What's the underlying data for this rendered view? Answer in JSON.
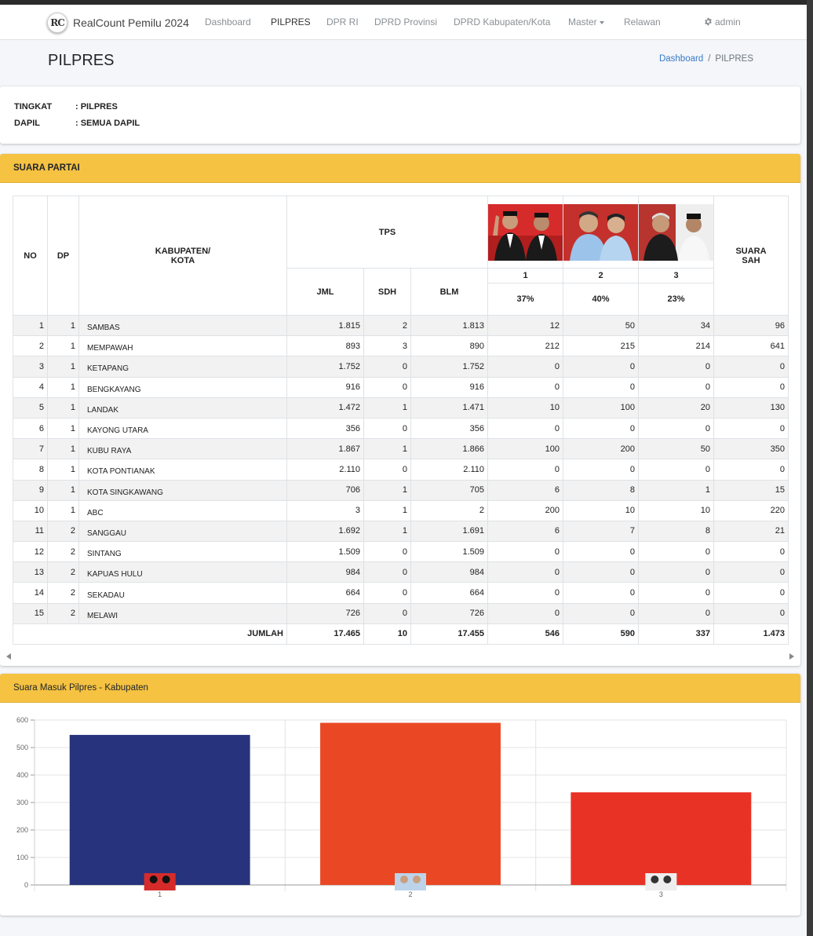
{
  "brand": {
    "logo_text": "RC",
    "name": "RealCount Pemilu 2024"
  },
  "nav": {
    "items": [
      {
        "label": "Dashboard"
      },
      {
        "label": "PILPRES"
      },
      {
        "label": "DPR RI"
      },
      {
        "label": "DPRD Provinsi"
      },
      {
        "label": "DPRD Kabupaten/Kota"
      },
      {
        "label": "Master"
      },
      {
        "label": "Relawan"
      }
    ],
    "user": "admin"
  },
  "page": {
    "title": "PILPRES"
  },
  "breadcrumb": {
    "home": "Dashboard",
    "current": "PILPRES"
  },
  "info": {
    "tingkat_label": "TINGKAT",
    "tingkat_value": ": PILPRES",
    "dapil_label": "DAPIL",
    "dapil_value": ": SEMUA DAPIL"
  },
  "table_card": {
    "title": "SUARA PARTAI"
  },
  "table": {
    "headers": {
      "no": "NO",
      "dp": "DP",
      "kab_line1": "KABUPATEN/",
      "kab_line2": "KOTA",
      "tps": "TPS",
      "jml": "JML",
      "sdh": "SDH",
      "blm": "BLM",
      "suara_line1": "SUARA",
      "suara_line2": "SAH"
    },
    "candidates": [
      {
        "no": "1",
        "pct": "37%",
        "bg": "#d62b2b"
      },
      {
        "no": "2",
        "pct": "40%",
        "bg": "#bcd3ea"
      },
      {
        "no": "3",
        "pct": "23%",
        "bg": "#b8342f"
      }
    ],
    "rows": [
      {
        "no": "1",
        "dp": "1",
        "name": "SAMBAS",
        "jml": "1.815",
        "sdh": "2",
        "blm": "1.813",
        "c1": "12",
        "c2": "50",
        "c3": "34",
        "sah": "96"
      },
      {
        "no": "2",
        "dp": "1",
        "name": "MEMPAWAH",
        "jml": "893",
        "sdh": "3",
        "blm": "890",
        "c1": "212",
        "c2": "215",
        "c3": "214",
        "sah": "641"
      },
      {
        "no": "3",
        "dp": "1",
        "name": "KETAPANG",
        "jml": "1.752",
        "sdh": "0",
        "blm": "1.752",
        "c1": "0",
        "c2": "0",
        "c3": "0",
        "sah": "0"
      },
      {
        "no": "4",
        "dp": "1",
        "name": "BENGKAYANG",
        "jml": "916",
        "sdh": "0",
        "blm": "916",
        "c1": "0",
        "c2": "0",
        "c3": "0",
        "sah": "0"
      },
      {
        "no": "5",
        "dp": "1",
        "name": "LANDAK",
        "jml": "1.472",
        "sdh": "1",
        "blm": "1.471",
        "c1": "10",
        "c2": "100",
        "c3": "20",
        "sah": "130"
      },
      {
        "no": "6",
        "dp": "1",
        "name": "KAYONG UTARA",
        "jml": "356",
        "sdh": "0",
        "blm": "356",
        "c1": "0",
        "c2": "0",
        "c3": "0",
        "sah": "0"
      },
      {
        "no": "7",
        "dp": "1",
        "name": "KUBU RAYA",
        "jml": "1.867",
        "sdh": "1",
        "blm": "1.866",
        "c1": "100",
        "c2": "200",
        "c3": "50",
        "sah": "350"
      },
      {
        "no": "8",
        "dp": "1",
        "name": "KOTA PONTIANAK",
        "jml": "2.110",
        "sdh": "0",
        "blm": "2.110",
        "c1": "0",
        "c2": "0",
        "c3": "0",
        "sah": "0"
      },
      {
        "no": "9",
        "dp": "1",
        "name": "KOTA SINGKAWANG",
        "jml": "706",
        "sdh": "1",
        "blm": "705",
        "c1": "6",
        "c2": "8",
        "c3": "1",
        "sah": "15"
      },
      {
        "no": "10",
        "dp": "1",
        "name": "ABC",
        "jml": "3",
        "sdh": "1",
        "blm": "2",
        "c1": "200",
        "c2": "10",
        "c3": "10",
        "sah": "220"
      },
      {
        "no": "11",
        "dp": "2",
        "name": "SANGGAU",
        "jml": "1.692",
        "sdh": "1",
        "blm": "1.691",
        "c1": "6",
        "c2": "7",
        "c3": "8",
        "sah": "21"
      },
      {
        "no": "12",
        "dp": "2",
        "name": "SINTANG",
        "jml": "1.509",
        "sdh": "0",
        "blm": "1.509",
        "c1": "0",
        "c2": "0",
        "c3": "0",
        "sah": "0"
      },
      {
        "no": "13",
        "dp": "2",
        "name": "KAPUAS HULU",
        "jml": "984",
        "sdh": "0",
        "blm": "984",
        "c1": "0",
        "c2": "0",
        "c3": "0",
        "sah": "0"
      },
      {
        "no": "14",
        "dp": "2",
        "name": "SEKADAU",
        "jml": "664",
        "sdh": "0",
        "blm": "664",
        "c1": "0",
        "c2": "0",
        "c3": "0",
        "sah": "0"
      },
      {
        "no": "15",
        "dp": "2",
        "name": "MELAWI",
        "jml": "726",
        "sdh": "0",
        "blm": "726",
        "c1": "0",
        "c2": "0",
        "c3": "0",
        "sah": "0"
      }
    ],
    "total": {
      "label": "JUMLAH",
      "jml": "17.465",
      "sdh": "10",
      "blm": "17.455",
      "c1": "546",
      "c2": "590",
      "c3": "337",
      "sah": "1.473"
    }
  },
  "chart_card": {
    "title": "Suara Masuk Pilpres - Kabupaten"
  },
  "chart_data": {
    "type": "bar",
    "title": "",
    "xlabel": "",
    "ylabel": "",
    "categories": [
      "1",
      "2",
      "3"
    ],
    "values": [
      546,
      590,
      337
    ],
    "colors": [
      "#27337c",
      "#ea4825",
      "#e93226"
    ],
    "ylim": [
      0,
      600
    ],
    "yticks": [
      0,
      100,
      200,
      300,
      400,
      500,
      600
    ],
    "grid": true
  }
}
